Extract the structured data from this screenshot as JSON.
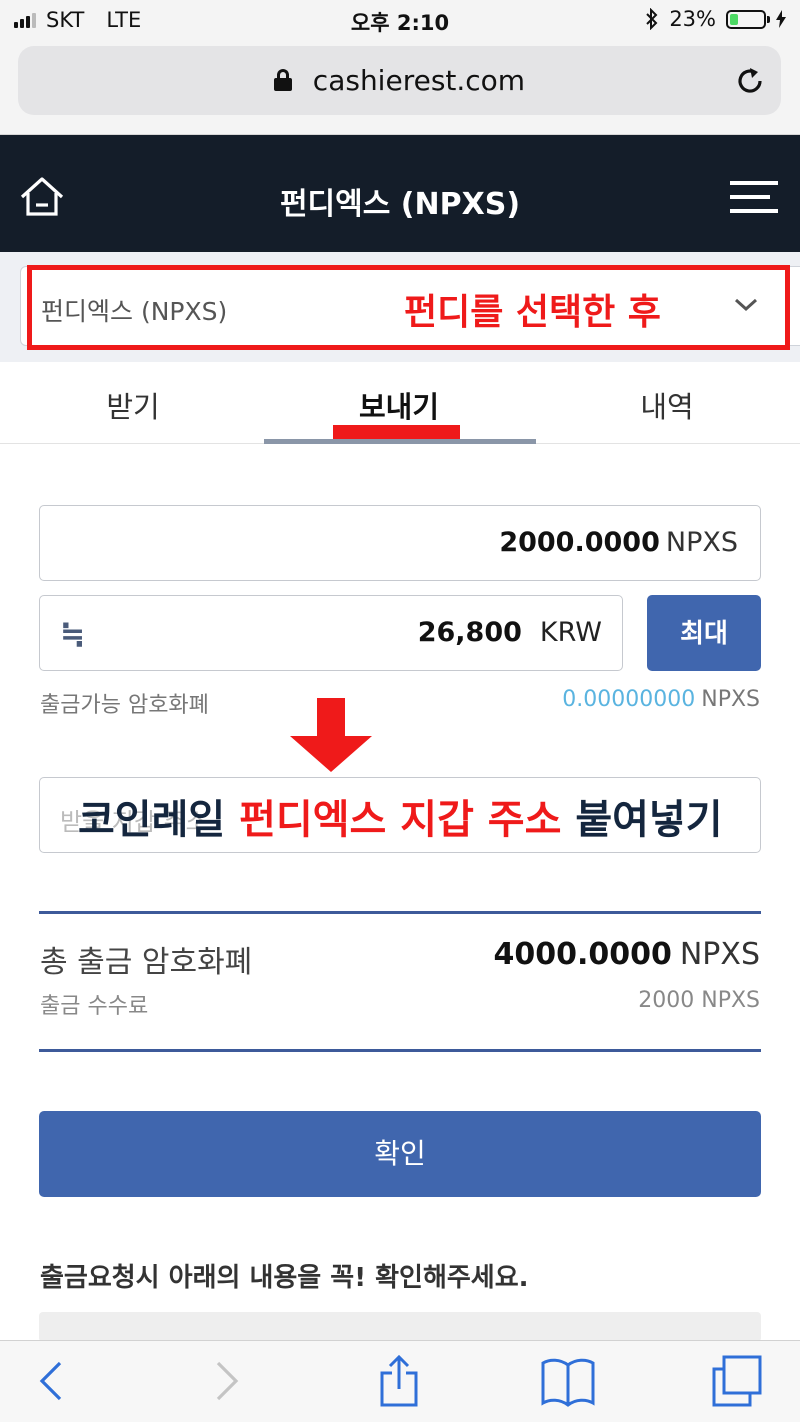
{
  "status_bar": {
    "carrier": "SKT",
    "network": "LTE",
    "time": "오후 2:10",
    "battery": "23%"
  },
  "browser": {
    "url": "cashierest.com"
  },
  "header": {
    "title": "펀디엑스 (NPXS)"
  },
  "coin_select": {
    "selected": "펀디엑스 (NPXS)"
  },
  "annotations": {
    "select_note": "펀디를 선택한 후",
    "paste_prefix": "코인레일 ",
    "paste_highlight": "펀디엑스 지갑 주소",
    "paste_suffix": " 붙여넣기"
  },
  "tabs": [
    {
      "label": "받기"
    },
    {
      "label": "보내기"
    },
    {
      "label": "내역"
    }
  ],
  "form": {
    "amount": "2000.0000",
    "amount_unit": "NPXS",
    "approx_symbol": "≒",
    "krw_amount": "26,800",
    "krw_unit": "KRW",
    "max_label": "최대",
    "available_label": "출금가능 암호화폐",
    "available_value": "0.00000000",
    "available_unit": "NPXS",
    "address_placeholder": "받을 지갑 주소"
  },
  "summary": {
    "total_label": "총 출금 암호화폐",
    "total_value": "4000.0000",
    "total_unit": "NPXS",
    "fee_label": "출금 수수료",
    "fee_value": "2000 NPXS"
  },
  "confirm_label": "확인",
  "notice_text": "출금요청시 아래의 내용을 꼭! 확인해주세요.",
  "colors": {
    "header_bg": "#141d29",
    "primary_button": "#4066ae",
    "annotation_red": "#ef1a1a",
    "available_value": "#5ab4e0"
  },
  "icons": {
    "home": "home-icon",
    "menu": "hamburger-menu-icon",
    "lock": "lock-icon",
    "reload": "reload-icon",
    "chevron": "chevron-down-icon",
    "arrow": "red-down-arrow-icon",
    "back": "back-icon",
    "forward": "forward-icon",
    "share": "share-icon",
    "bookmarks": "bookmarks-icon",
    "tabs": "tabs-icon"
  }
}
